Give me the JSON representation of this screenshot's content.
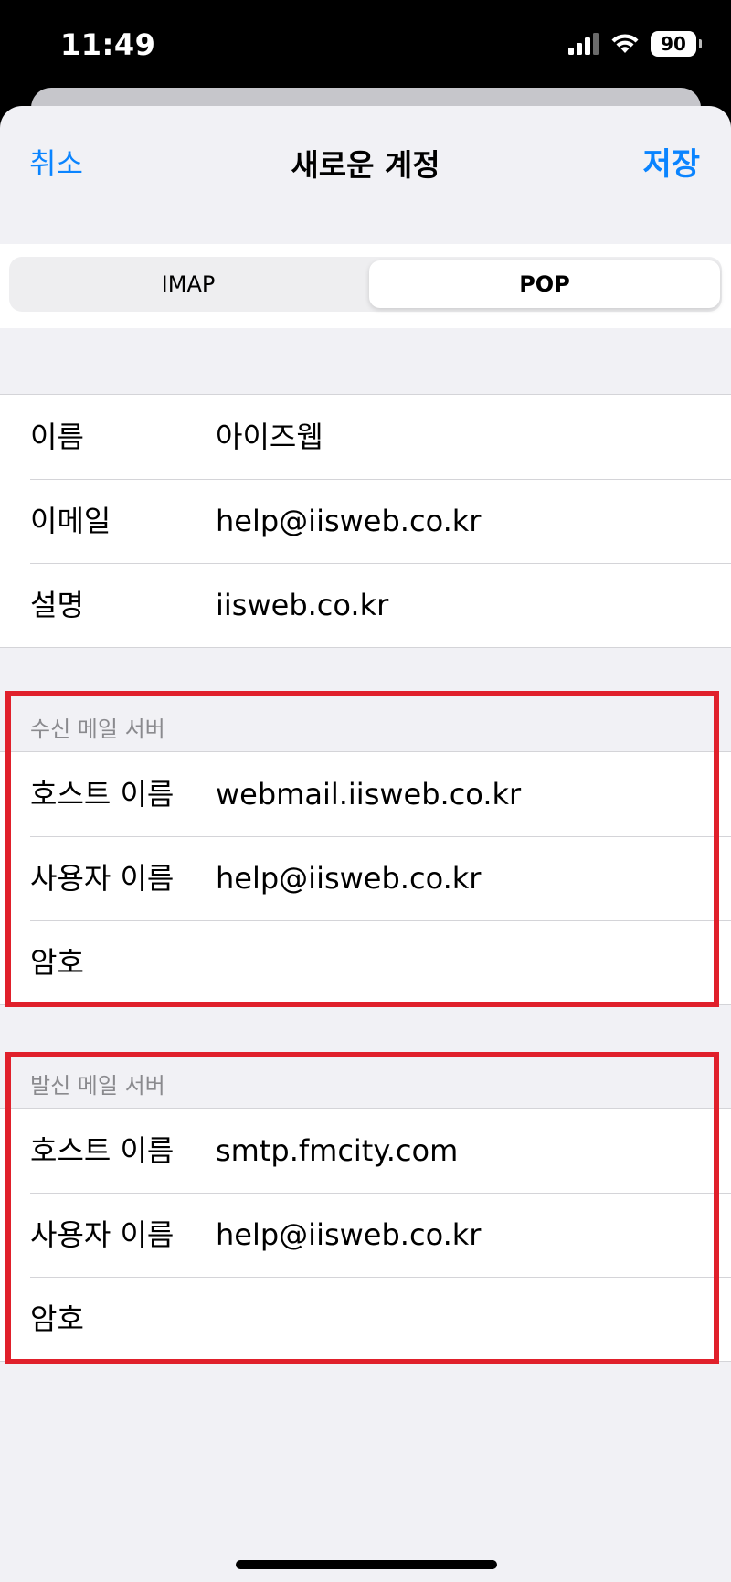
{
  "status": {
    "time": "11:49",
    "battery": "90"
  },
  "nav": {
    "cancel": "취소",
    "title": "새로운 계정",
    "save": "저장"
  },
  "segment": {
    "imap": "IMAP",
    "pop": "POP",
    "selected": "POP"
  },
  "account": {
    "name_label": "이름",
    "name_value": "아이즈웹",
    "email_label": "이메일",
    "email_value": "help@iisweb.co.kr",
    "desc_label": "설명",
    "desc_value": "iisweb.co.kr"
  },
  "incoming": {
    "header": "수신 메일 서버",
    "host_label": "호스트 이름",
    "host_value": "webmail.iisweb.co.kr",
    "user_label": "사용자 이름",
    "user_value": "help@iisweb.co.kr",
    "password_label": "암호"
  },
  "outgoing": {
    "header": "발신 메일 서버",
    "host_label": "호스트 이름",
    "host_value": "smtp.fmcity.com",
    "user_label": "사용자 이름",
    "user_value": "help@iisweb.co.kr",
    "password_label": "암호"
  },
  "colors": {
    "accent": "#0a84ff",
    "highlight": "#e0202b",
    "background": "#f1f1f5"
  }
}
